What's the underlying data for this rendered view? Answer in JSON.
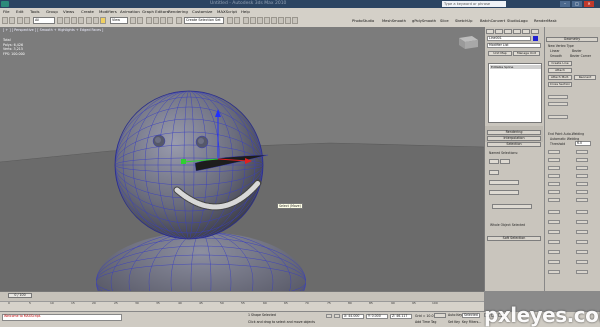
{
  "app": {
    "title_bar": "Untitled - Autodesk 3ds Max 2010",
    "search_placeholder": "Type a keyword or phrase",
    "window_buttons": [
      "–",
      "□",
      "✕"
    ]
  },
  "menu": [
    "File",
    "Edit",
    "Tools",
    "Group",
    "Views",
    "Create",
    "Modifiers",
    "Animation",
    "Graph Editors",
    "Rendering",
    "Customize",
    "MAXScript",
    "Help"
  ],
  "toolbar": {
    "selection_filter": "All",
    "view_dropdown": "View",
    "named_selection": "Create Selection Set",
    "right_labels": [
      "PhotoStudio",
      "MeshSmooth",
      "gPolySmooth",
      "Slice",
      "SketchUp",
      "BatchConvert",
      "StudioLogo",
      "RenderMask"
    ]
  },
  "viewport": {
    "label": "[ + ] [ Perspective ] [ Smooth + Highlights + Edged Faces ]",
    "stats": [
      "Total",
      "Polys: 6,426",
      "Verts: 3,215",
      "",
      "FPS: 100.000"
    ],
    "tooltip": "Select (Move)"
  },
  "command_panel": {
    "object_name": "Line001",
    "modifier_list": "Modifier List",
    "stack_items": [
      "Editable Spline"
    ],
    "buttons": [
      "Unit Map",
      "Manage Unit"
    ],
    "rollouts": [
      "Rendering",
      "Interpolation",
      "Selection",
      "Soft Selection"
    ],
    "named_selections_label": "Named Selections:",
    "vertex_label": "Whole Object Selected"
  },
  "right_panel": {
    "header": "Geometry",
    "new_vertex_type": "New Vertex Type",
    "options": [
      "Linear",
      "Bezier",
      "Smooth",
      "Bezier Corner"
    ],
    "buttons": [
      "Create Line",
      "Attach",
      "Attach Mult.",
      "Cross Section",
      "Reorient"
    ],
    "end_point": "End Point Auto-Welding",
    "automatic_welding": "Automatic Welding",
    "threshold_label": "Threshold",
    "threshold_value": "6.0"
  },
  "timeline": {
    "slider": "0 / 100",
    "ticks": [
      "0",
      "5",
      "10",
      "15",
      "20",
      "25",
      "30",
      "35",
      "40",
      "45",
      "50",
      "55",
      "60",
      "65",
      "70",
      "75",
      "80",
      "85",
      "90",
      "95",
      "100"
    ]
  },
  "status": {
    "maxscript": "Welcome to MAXScript.",
    "selection": "1 Shape Selected",
    "prompt": "Click and drag to select and move objects",
    "x": "X: 44.000",
    "y": "Y: 0.000",
    "z": "Z: 46.117",
    "grid": "Grid = 10.0",
    "add_time_tag": "Add Time Tag",
    "auto_key": "Auto Key",
    "selected": "Selected",
    "set_key": "Set Key",
    "key_filters": "Key Filters..."
  },
  "watermark": "pxleyes.com",
  "colors": {
    "wire": "#3a3fbf",
    "body": "#777986",
    "nose": "#1d1d1d",
    "mouth": "#d8d8d8",
    "title_bg": "#2b4462",
    "ui_bg": "#d4d0c8"
  }
}
